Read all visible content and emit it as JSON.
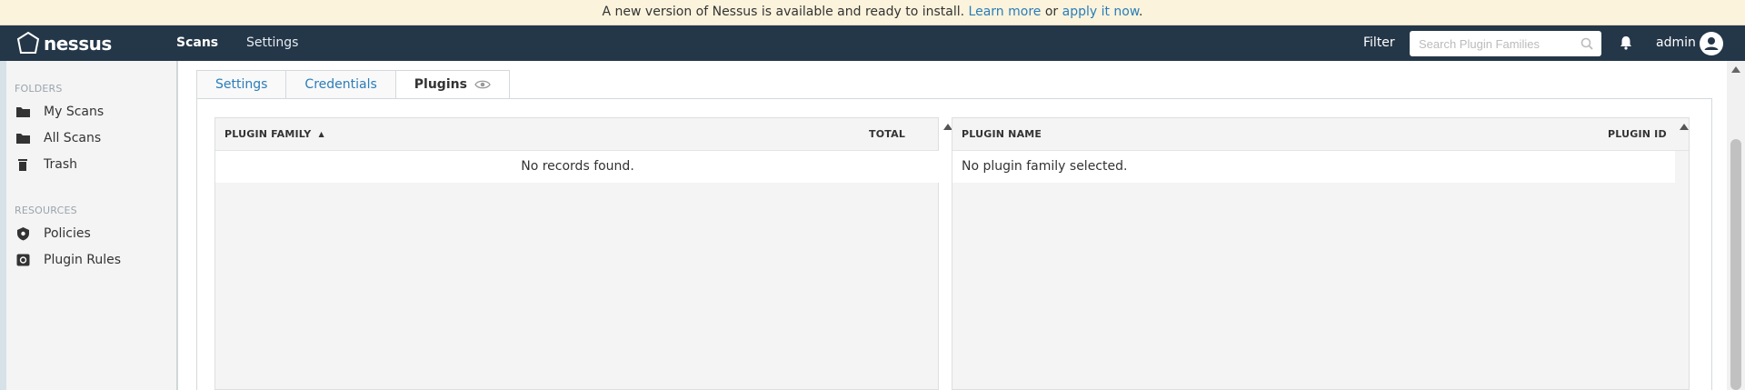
{
  "banner": {
    "message": "A new version of Nessus is available and ready to install.",
    "learn_more": "Learn more",
    "or": "or",
    "apply": "apply it now",
    "period": "."
  },
  "header": {
    "logo_text": "nessus",
    "nav": [
      {
        "label": "Scans",
        "active": true
      },
      {
        "label": "Settings",
        "active": false
      }
    ],
    "filter_label": "Filter",
    "search_placeholder": "Search Plugin Families",
    "user": "admin",
    "bar_color": "#243748"
  },
  "sidebar": {
    "folders_heading": "FOLDERS",
    "folders": [
      {
        "label": "My Scans",
        "icon": "folder-icon"
      },
      {
        "label": "All Scans",
        "icon": "folder-icon"
      },
      {
        "label": "Trash",
        "icon": "trash-icon"
      }
    ],
    "resources_heading": "RESOURCES",
    "resources": [
      {
        "label": "Policies",
        "icon": "shield-icon"
      },
      {
        "label": "Plugin Rules",
        "icon": "plugin-rules-icon"
      }
    ]
  },
  "tabs": [
    {
      "label": "Settings",
      "active": false
    },
    {
      "label": "Credentials",
      "active": false
    },
    {
      "label": "Plugins",
      "active": true,
      "icon": "eye-icon"
    }
  ],
  "families_table": {
    "columns": [
      "PLUGIN FAMILY",
      "TOTAL"
    ],
    "sort_indicator": "▲",
    "empty_message": "No records found."
  },
  "plugins_table": {
    "columns": [
      "PLUGIN NAME",
      "PLUGIN ID"
    ],
    "empty_message": "No plugin family selected."
  },
  "colors": {
    "link": "#2a7db8",
    "banner_bg": "#fbf3dc"
  }
}
